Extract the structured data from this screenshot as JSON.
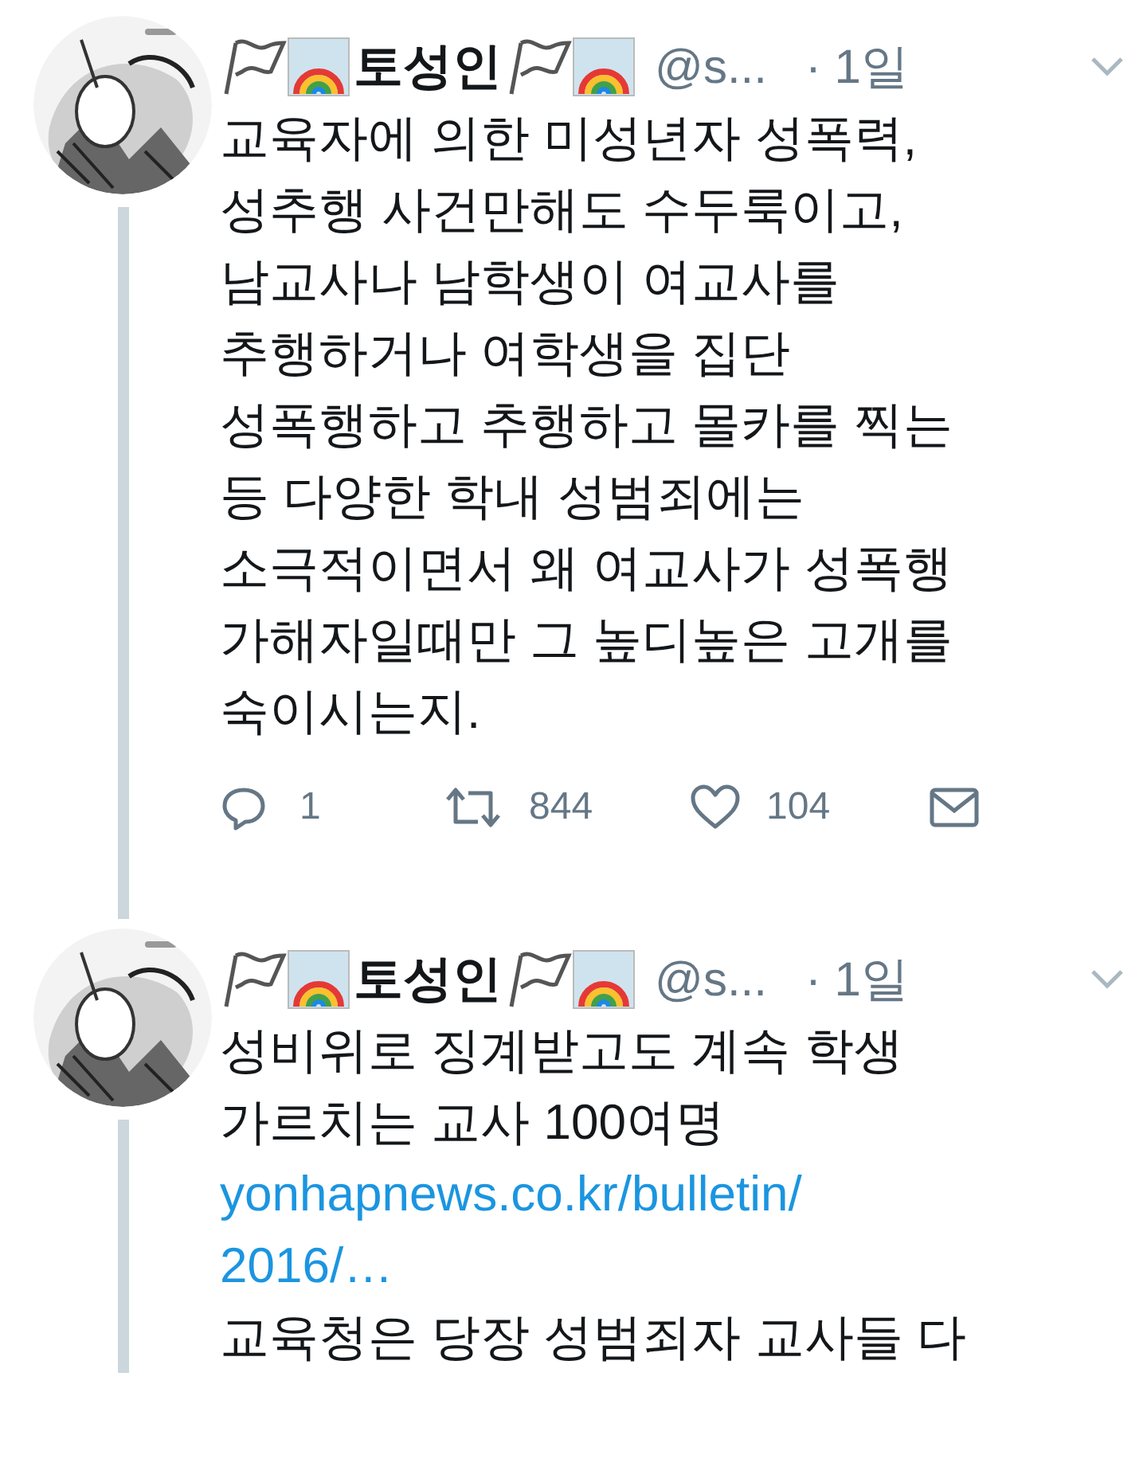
{
  "tweets": [
    {
      "author": {
        "name": "토성인",
        "handle": "@s..."
      },
      "time": "· 1일",
      "thread_line": true,
      "body": [
        {
          "kind": "text",
          "text": "교육자에 의한 미성년자 성폭력,\n성추행 사건만해도 수두룩이고,\n남교사나 남학생이 여교사를\n추행하거나 여학생을 집단\n성폭행하고 추행하고 몰카를 찍는\n등 다양한 학내 성범죄에는\n소극적이면서 왜 여교사가 성폭행\n가해자일때만 그 높디높은 고개를\n숙이시는지."
        }
      ],
      "actions": {
        "replies": "1",
        "retweets": "844",
        "likes": "104"
      }
    },
    {
      "author": {
        "name": "토성인",
        "handle": "@s..."
      },
      "time": "· 1일",
      "thread_line": true,
      "body": [
        {
          "kind": "text",
          "text": "성비위로 징계받고도 계속 학생\n가르치는 교사 100여명"
        },
        {
          "kind": "link",
          "text": "yonhapnews.co.kr/bulletin/\n2016/…"
        },
        {
          "kind": "text",
          "text": "교육청은 당장 성범죄자 교사들 다"
        }
      ]
    }
  ]
}
